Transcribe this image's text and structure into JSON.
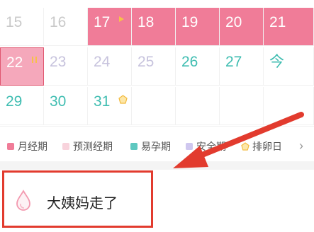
{
  "calendar": {
    "row1": [
      "15",
      "16",
      "17",
      "18",
      "19",
      "20",
      "21"
    ],
    "row2": [
      "22",
      "23",
      "24",
      "25",
      "26",
      "27",
      "今"
    ],
    "row3": [
      "29",
      "30",
      "31"
    ]
  },
  "legend": {
    "period": "月经期",
    "predicted_period": "预测经期",
    "fertile": "易孕期",
    "safe": "安全期",
    "ovulation": "排卵日",
    "more": "›"
  },
  "record": {
    "label": "大姨妈走了",
    "icon": "drop-icon"
  },
  "colors": {
    "period": "#f07c98",
    "predicted": "#f8d3dc",
    "fertile": "#5ec8c0",
    "safe": "#cfc7ef",
    "ovulation": "#f7c04a",
    "annotation": "#e23b2e"
  }
}
